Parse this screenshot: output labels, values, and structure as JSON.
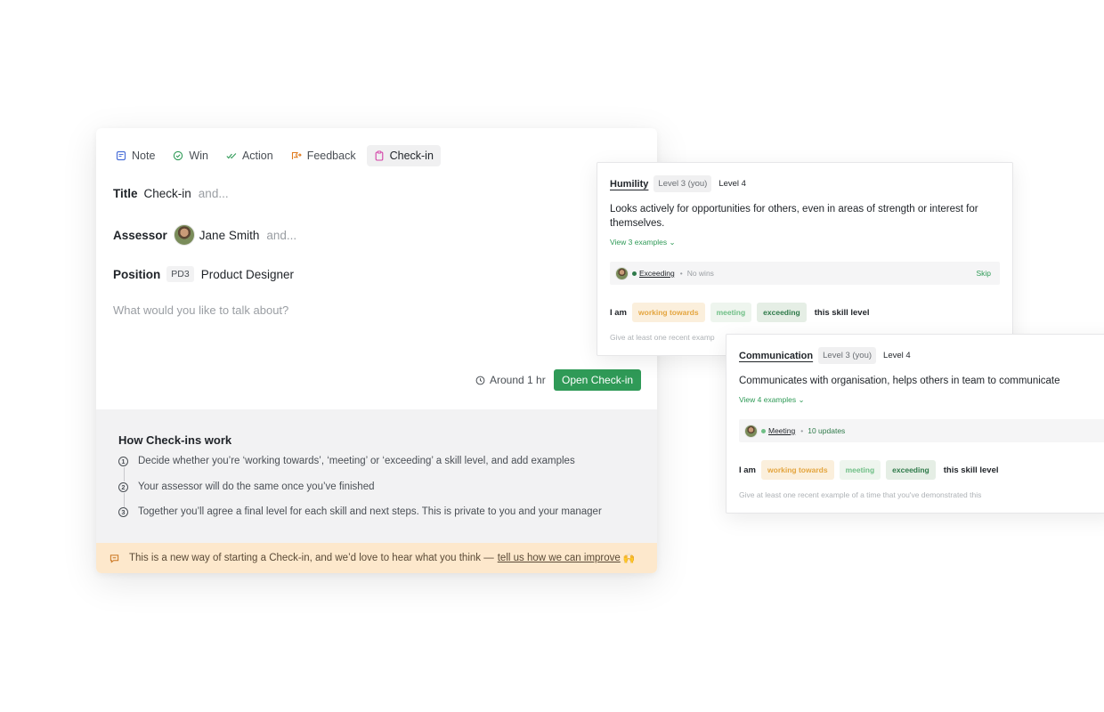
{
  "composer": {
    "tabs": [
      {
        "label": "Note",
        "icon": "note-icon",
        "color": "#4a6fd8"
      },
      {
        "label": "Win",
        "icon": "check-circle-icon",
        "color": "#2f9a57"
      },
      {
        "label": "Action",
        "icon": "check-double-icon",
        "color": "#2f9a57"
      },
      {
        "label": "Feedback",
        "icon": "feedback-arrow-icon",
        "color": "#e07b1f"
      },
      {
        "label": "Check-in",
        "icon": "clipboard-icon",
        "color": "#d23fa6"
      }
    ],
    "active_tab": "Check-in",
    "title": {
      "label": "Title",
      "value": "Check-in",
      "suffix": "and..."
    },
    "assessor": {
      "label": "Assessor",
      "name": "Jane Smith",
      "suffix": "and..."
    },
    "position": {
      "label": "Position",
      "code": "PD3",
      "value": "Product Designer"
    },
    "talk_placeholder": "What would you like to talk about?",
    "duration": "Around 1 hr",
    "open_button": "Open Check-in",
    "accent": "#2f9a57"
  },
  "how_it_works": {
    "heading": "How Check-ins work",
    "steps": [
      {
        "num": "1",
        "text": "Decide whether you’re ‘working towards’, ‘meeting’ or ‘exceeding’ a skill level, and add examples"
      },
      {
        "num": "2",
        "text": "Your assessor will do the same once you’ve finished"
      },
      {
        "num": "3",
        "text": "Together you’ll agree a final level for each skill and next steps. This is private to you and your manager"
      }
    ]
  },
  "banner": {
    "text": "This is a new way of starting a Check-in, and we’d love to hear what you think —",
    "link": "tell us how we can improve",
    "emoji": "🙌",
    "background": "#fde8cc"
  },
  "skills": [
    {
      "name": "Humility",
      "current_level": "Level 3 (you)",
      "next_level": "Level 4",
      "description": "Looks actively for opportunities for others, even in areas of strength or interest for themselves.",
      "view_examples": "View 3 examples ⌄",
      "status": "Exceeding",
      "status_color": "#2f7a4a",
      "meta": "No wins",
      "skip": "Skip",
      "choice_prefix": "I am",
      "choices": [
        "working towards",
        "meeting",
        "exceeding"
      ],
      "choice_suffix": "this skill level",
      "hint": "Give at least one recent examp"
    },
    {
      "name": "Communication",
      "current_level": "Level 3 (you)",
      "next_level": "Level 4",
      "description": "Communicates with organisation, helps others in team to communicate",
      "view_examples": "View 4 examples ⌄",
      "status": "Meeting",
      "status_color": "#6fbf86",
      "meta": "10 updates",
      "choice_prefix": "I am",
      "choices": [
        "working towards",
        "meeting",
        "exceeding"
      ],
      "choice_suffix": "this skill level",
      "hint": "Give at least one recent example of a time that you've demonstrated this"
    }
  ]
}
